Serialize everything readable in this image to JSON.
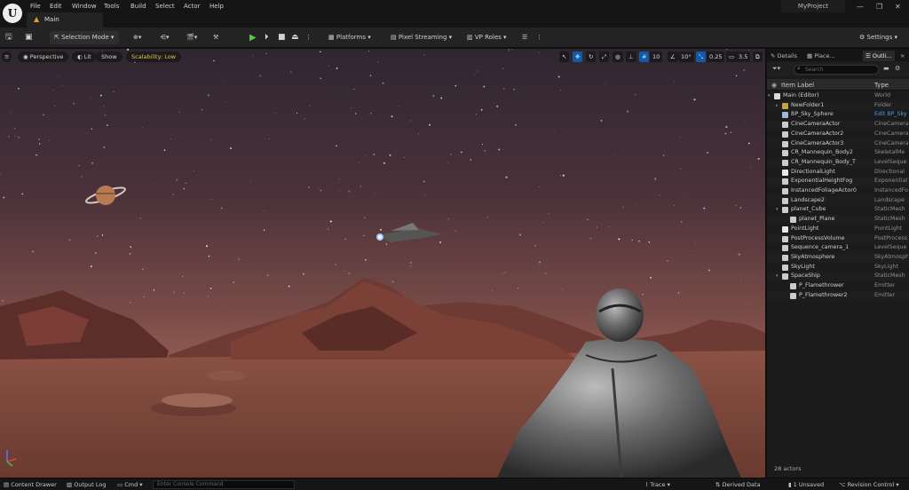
{
  "menu": [
    "File",
    "Edit",
    "Window",
    "Tools",
    "Build",
    "Select",
    "Actor",
    "Help"
  ],
  "tab_main": "Main",
  "project": "MyProject",
  "toolbar": {
    "selection_mode": "Selection Mode",
    "platforms": "Platforms",
    "pixel_streaming": "Pixel Streaming",
    "vp_roles": "VP Roles",
    "settings": "Settings"
  },
  "viewport": {
    "perspective": "Perspective",
    "lit": "Lit",
    "show": "Show",
    "scalability": "Scalability: Low",
    "grid_snap": "10",
    "rot_snap": "10°",
    "scale_snap": "0.25",
    "cam_speed": "3.5"
  },
  "outliner": {
    "tabs": [
      "Details",
      "Place...",
      "Outli..."
    ],
    "search_placeholder": "Search",
    "col_label": "Item Label",
    "col_type": "Type",
    "items": [
      {
        "label": "Main (Editor)",
        "type": "World",
        "indent": 0,
        "color": "#d9d9d9"
      },
      {
        "label": "NewFolder1",
        "type": "Folder",
        "indent": 1,
        "color": "#c9a04a"
      },
      {
        "label": "BP_Sky_Sphere",
        "type": "Edit BP_Sky",
        "indent": 1,
        "color": "#9bb8d9",
        "link": true
      },
      {
        "label": "CineCameraActor",
        "type": "CineCamera",
        "indent": 1,
        "color": "#cccccc"
      },
      {
        "label": "CineCameraActor2",
        "type": "CineCamera",
        "indent": 1,
        "color": "#cccccc"
      },
      {
        "label": "CineCameraActor3",
        "type": "CineCamera",
        "indent": 1,
        "color": "#cccccc"
      },
      {
        "label": "CR_Mannequin_Body2",
        "type": "SkeletalMe",
        "indent": 1,
        "color": "#cccccc"
      },
      {
        "label": "CR_Mannequin_Body_T",
        "type": "LevelSeque",
        "indent": 1,
        "color": "#cccccc"
      },
      {
        "label": "DirectionalLight",
        "type": "Directional",
        "indent": 1,
        "color": "#e8e8e8"
      },
      {
        "label": "ExponentialHeightFog",
        "type": "Exponential",
        "indent": 1,
        "color": "#cccccc"
      },
      {
        "label": "InstancedFoliageActor0",
        "type": "InstancedFo",
        "indent": 1,
        "color": "#cccccc"
      },
      {
        "label": "Landscape2",
        "type": "Landscape",
        "indent": 1,
        "color": "#cccccc"
      },
      {
        "label": "planet_Cube",
        "type": "StaticMesh",
        "indent": 1,
        "color": "#cccccc"
      },
      {
        "label": "planet_Plane",
        "type": "StaticMesh",
        "indent": 2,
        "color": "#cccccc"
      },
      {
        "label": "PointLight",
        "type": "PointLight",
        "indent": 1,
        "color": "#e8e8e8"
      },
      {
        "label": "PostProcessVolume",
        "type": "PostProcess",
        "indent": 1,
        "color": "#cccccc"
      },
      {
        "label": "Sequence_camera_1",
        "type": "LevelSeque",
        "indent": 1,
        "color": "#cccccc"
      },
      {
        "label": "SkyAtmosphere",
        "type": "SkyAtmosph",
        "indent": 1,
        "color": "#cccccc"
      },
      {
        "label": "SkyLight",
        "type": "SkyLight",
        "indent": 1,
        "color": "#cccccc"
      },
      {
        "label": "SpaceShip",
        "type": "StaticMesh",
        "indent": 1,
        "color": "#cccccc"
      },
      {
        "label": "P_Flamethrower",
        "type": "Emitter",
        "indent": 2,
        "color": "#cccccc"
      },
      {
        "label": "P_Flamethrower2",
        "type": "Emitter",
        "indent": 2,
        "color": "#cccccc"
      }
    ],
    "count": "28 actors"
  },
  "statusbar": {
    "content_drawer": "Content Drawer",
    "output_log": "Output Log",
    "cmd": "Cmd",
    "console_placeholder": "Enter Console Command",
    "trace": "Trace",
    "derived_data": "Derived Data",
    "unsaved": "1 Unsaved",
    "revision": "Revision Control"
  },
  "colors": {
    "accent": "#e59a3a",
    "play": "#5ec24e",
    "selected": "#0e5ba8"
  }
}
